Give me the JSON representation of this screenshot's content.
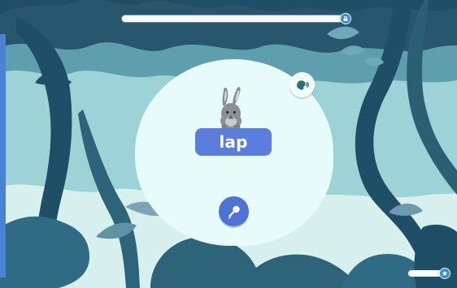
{
  "app": {
    "word": "lap"
  },
  "progress": {
    "top_fill_fraction": 0.98,
    "bottom_fill_fraction": 0.85
  },
  "icons": {
    "top_lock": "lock-icon",
    "sound": "speaker-head-icon",
    "character": "bunny-icon",
    "mic": "microphone-icon",
    "bottom_star": "star-icon"
  },
  "colors": {
    "background_dark": "#2f6f7d",
    "foliage_dark": "#1f4f66",
    "foliage_mid": "#7fb8c0",
    "bubble": "#e8fbfb",
    "word_card": "#5b7ddc",
    "mic_button": "#4e73d8",
    "progress_end": "#3e89d3"
  }
}
